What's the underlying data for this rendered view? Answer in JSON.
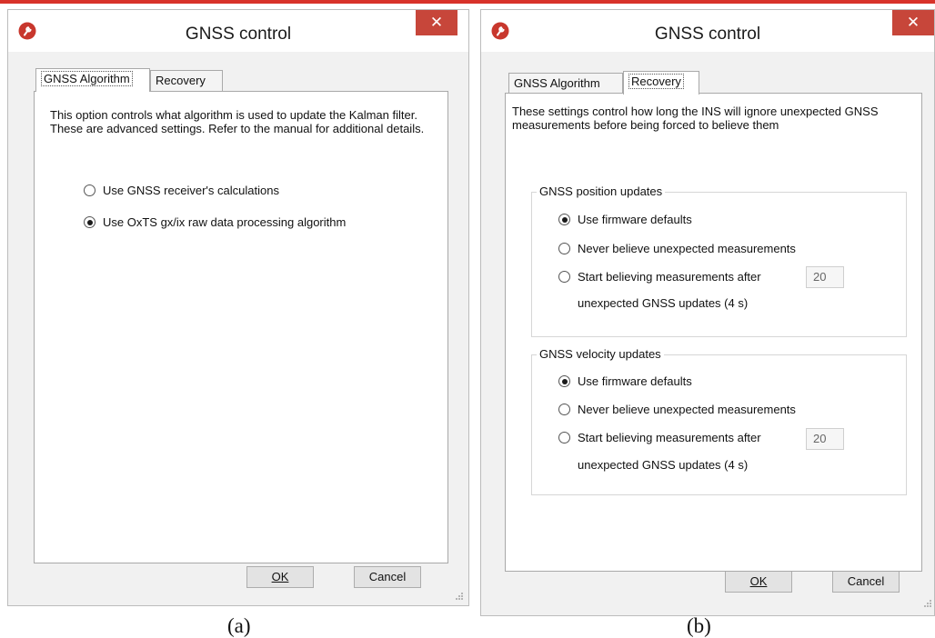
{
  "window_a": {
    "title": "GNSS control",
    "close": "✕",
    "tabs": [
      "GNSS Algorithm",
      "Recovery"
    ],
    "active_tab": 0,
    "description": "This option controls what algorithm is used to update the Kalman filter.  These are advanced settings.  Refer to the manual for additional details.",
    "options": [
      {
        "label": "Use GNSS receiver's calculations",
        "checked": false
      },
      {
        "label": "Use OxTS gx/ix raw data processing algorithm",
        "checked": true
      }
    ],
    "ok_label": "OK",
    "cancel_label": "Cancel"
  },
  "window_b": {
    "title": "GNSS control",
    "close": "✕",
    "tabs": [
      "GNSS Algorithm",
      "Recovery"
    ],
    "active_tab": 1,
    "description": "These settings control how long the INS will ignore unexpected GNSS measurements before being forced to believe them",
    "position_group": {
      "title": "GNSS position updates",
      "options": [
        {
          "label": "Use firmware defaults",
          "checked": true
        },
        {
          "label": "Never believe unexpected measurements",
          "checked": false
        },
        {
          "label": "Start believing measurements after",
          "checked": false
        }
      ],
      "input_value": "20",
      "sub_label": "unexpected GNSS updates (4 s)"
    },
    "velocity_group": {
      "title": "GNSS velocity updates",
      "options": [
        {
          "label": "Use firmware defaults",
          "checked": true
        },
        {
          "label": "Never believe unexpected measurements",
          "checked": false
        },
        {
          "label": "Start believing measurements after",
          "checked": false
        }
      ],
      "input_value": "20",
      "sub_label": "unexpected GNSS updates (4 s)"
    },
    "ok_label": "OK",
    "cancel_label": "Cancel"
  },
  "captions": {
    "a": "(a)",
    "b": "(b)"
  },
  "colors": {
    "close_button": "#c7463a",
    "top_accent": "#d8322a",
    "app_icon": "#c8372d"
  }
}
